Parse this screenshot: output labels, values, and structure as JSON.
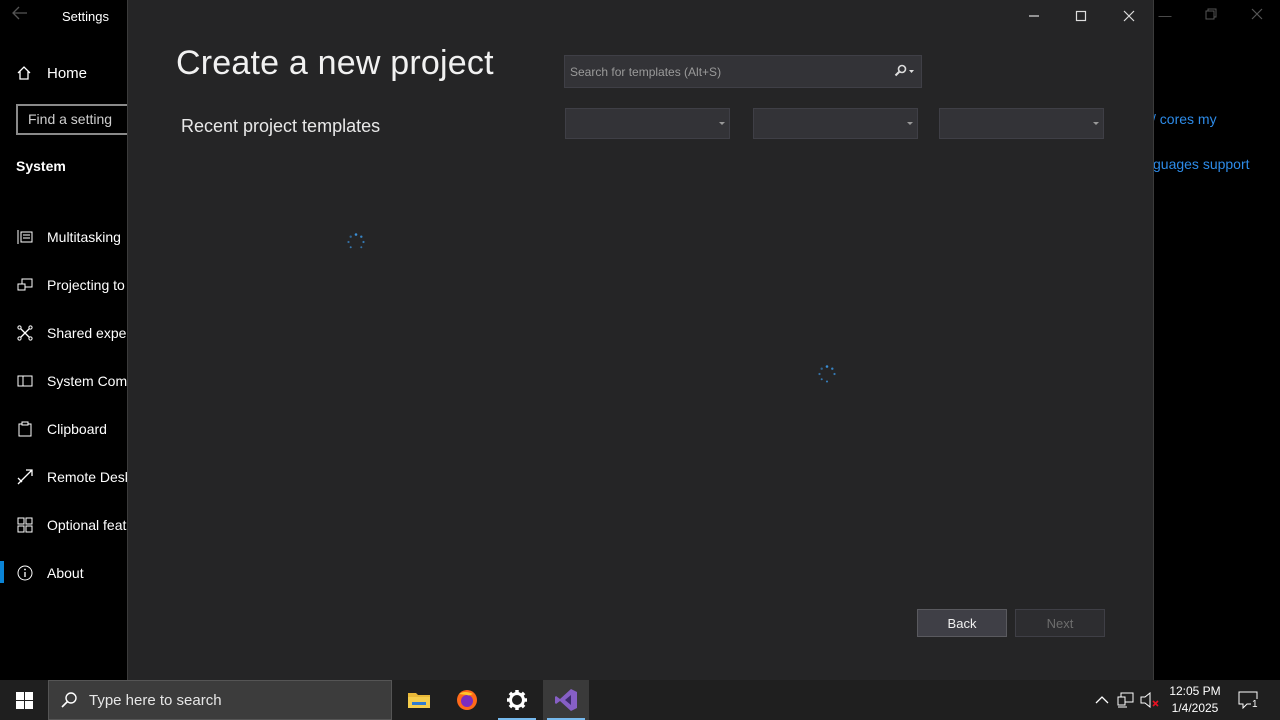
{
  "settings": {
    "title": "Settings",
    "home_label": "Home",
    "find_placeholder": "Find a setting",
    "section_label": "System",
    "nav_items": [
      {
        "label": "Multitasking",
        "icon": "multitasking-icon"
      },
      {
        "label": "Projecting to",
        "icon": "projecting-icon"
      },
      {
        "label": "Shared exper",
        "icon": "shared-experiences-icon"
      },
      {
        "label": "System Comp",
        "icon": "system-components-icon"
      },
      {
        "label": "Clipboard",
        "icon": "clipboard-icon"
      },
      {
        "label": "Remote Desk",
        "icon": "remote-desktop-icon"
      },
      {
        "label": "Optional feat",
        "icon": "optional-features-icon"
      },
      {
        "label": "About",
        "icon": "info-icon"
      }
    ],
    "links": [
      "/ cores my",
      "guages support"
    ]
  },
  "dialog": {
    "heading": "Create a new project",
    "recent_heading": "Recent project templates",
    "search_placeholder": "Search for templates (Alt+S)",
    "filters": [
      "",
      "",
      ""
    ],
    "back_label": "Back",
    "next_label": "Next"
  },
  "taskbar": {
    "search_placeholder": "Type here to search",
    "time": "12:05 PM",
    "date": "1/4/2025",
    "notification_count": "1",
    "apps": [
      "file-explorer-icon",
      "firefox-icon",
      "settings-gear-icon",
      "visual-studio-icon"
    ]
  },
  "colors": {
    "accent": "#0a84d6",
    "link": "#2d8be8",
    "dialog_bg": "#252526",
    "vs_purple": "#865fc5"
  }
}
